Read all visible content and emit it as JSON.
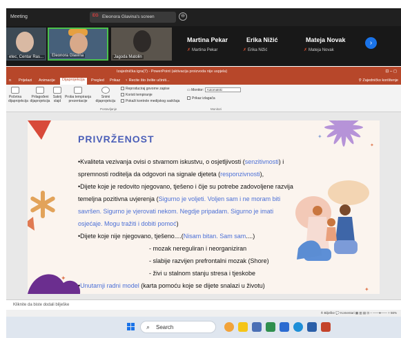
{
  "meeting": {
    "title": "Meeting",
    "share_badge": "EG",
    "share_label": "Eleonora Glavina's screen",
    "close_glyph": "⊖"
  },
  "participants": {
    "tiles": [
      {
        "name": "etec, Centar Ras..."
      },
      {
        "name": "Eleonora Glavina"
      },
      {
        "name": "Jagoda Matolin"
      }
    ],
    "named": [
      {
        "name": "Martina Pekar",
        "sub": "Martina Pekar"
      },
      {
        "name": "Erika Nižić",
        "sub": "Erika Nižić"
      },
      {
        "name": "Mateja Novak",
        "sub": "Mateja Novak"
      }
    ],
    "next_glyph": "›"
  },
  "powerpoint": {
    "window_title": "Izajednička igra(7) - PowerPoint (aktivacija proizvoda nije uspjela)",
    "window_controls": "⊡   –   ◻",
    "tabs": [
      "Prijelazi",
      "Animacije",
      "Dijaprojekcija",
      "Pregled",
      "Prikaz",
      "Recite što želite učiniti..."
    ],
    "share_right": "Zajedničko korištenje",
    "ribbon": {
      "buttons": [
        "Početna dijaprojekcija",
        "Prilagođeni dijaprojekcija",
        "Sakrij slajd",
        "Proba tempiranja prezentacije",
        "Snimi dijaprojekciju"
      ],
      "checkboxes": [
        "Reproduciraj govorne zapise",
        "Koristi tempiranje",
        "Pokaži kontrole medijskog sadržaja"
      ],
      "monitor_label": "Monitor:",
      "monitor_value": "Automatski",
      "presenter_view": "Prikaz izlagača",
      "group_postavljanje": "Postavljanje",
      "group_monitori": "Monitori"
    },
    "notes_placeholder": "Kliknite da biste dodali bilješke",
    "status_right": "≙ Bilješke   💬 Komentari   ▦  ▥  ▤  ⊡   –  ——●——  +  56%"
  },
  "slide": {
    "title": "PRIVRŽENOST",
    "lines": [
      {
        "parts": [
          {
            "t": "•Kvaliteta vezivanja ovisi o stvarnom iskustvu, o osjetljivosti (",
            "b": false
          },
          {
            "t": "senzitivnosti",
            "b": true
          },
          {
            "t": ") i",
            "b": false
          }
        ]
      },
      {
        "parts": [
          {
            "t": "spremnosti roditelja da odgovori na signale djeteta (",
            "b": false
          },
          {
            "t": "responzivnosti",
            "b": true
          },
          {
            "t": "),",
            "b": false
          }
        ]
      },
      {
        "parts": [
          {
            "t": "•Dijete koje je redovito njegovano, tješeno i čije su potrebe zadovoljene razvija",
            "b": false
          }
        ]
      },
      {
        "parts": [
          {
            "t": "temeljna pozitivna uvjerenja (",
            "b": false
          },
          {
            "t": "Sigurno je voljeti. Voljen sam i ne moram biti",
            "b": true
          }
        ]
      },
      {
        "parts": [
          {
            "t": "savršen. Sigurno je vjerovati nekom. Negdje pripadam. Sigurno je imati",
            "b": true
          }
        ]
      },
      {
        "parts": [
          {
            "t": "osjećaje. Mogu tražiti i dobiti pomoć",
            "b": true
          },
          {
            "t": ")",
            "b": false
          }
        ]
      },
      {
        "parts": [
          {
            "t": "•Dijete koje nije njegovano, tješeno....(",
            "b": false
          },
          {
            "t": "Nisam bitan. Sam sam",
            "b": true
          },
          {
            "t": "....)",
            "b": false
          }
        ]
      },
      {
        "parts": [
          {
            "t": "- mozak nereguliran i neorganiziran",
            "b": false
          }
        ]
      },
      {
        "parts": [
          {
            "t": "- slabije razvijen prefrontalni mozak (Shore)",
            "b": false
          }
        ]
      },
      {
        "parts": [
          {
            "t": "- živi u stalnom stanju stresa i tjeskobe",
            "b": false
          }
        ]
      },
      {
        "parts": [
          {
            "t": "•",
            "b": false
          },
          {
            "t": "Unutarnji radni model",
            "b": true
          },
          {
            "t": " (karta pomoću koje se dijete snalazi u životu)",
            "b": false
          }
        ]
      }
    ]
  },
  "taskbar": {
    "search_glyph": "⌕",
    "search_label": "Search"
  },
  "colors": {
    "accent_powerpoint": "#b7472a",
    "slide_title": "#4b5fb8",
    "slide_link": "#4b6fd6"
  }
}
